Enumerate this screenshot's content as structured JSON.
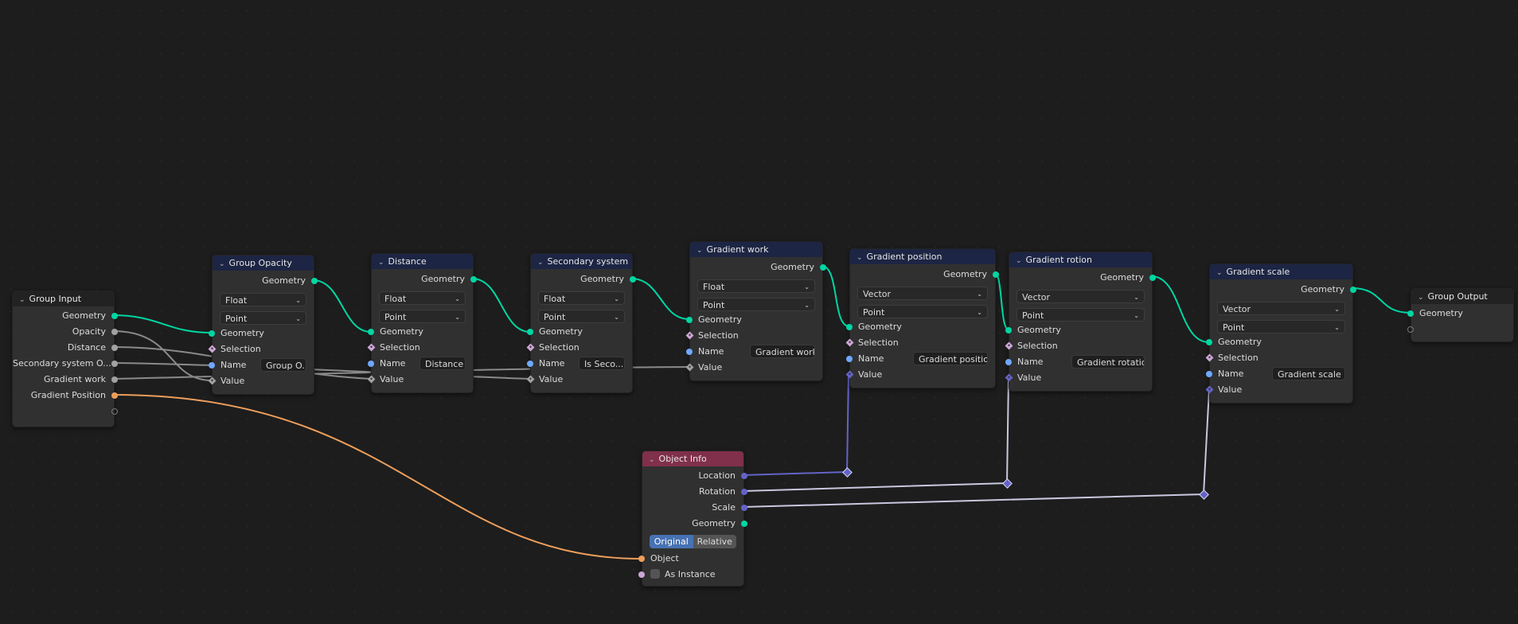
{
  "editor": {
    "type": "Geometry Node Editor"
  },
  "colors": {
    "geometry": "#00d6a3",
    "float": "#a1a1a1",
    "string": "#6fa8ff",
    "object": "#ed9e5c",
    "vector": "#6363c7",
    "boolean": "#cca6d6",
    "group_header": "#222222",
    "attribute_header": "#1d2544",
    "input_header": "#80304a"
  },
  "nodes": {
    "group_input": {
      "title": "Group Input",
      "outputs": [
        "Geometry",
        "Opacity",
        "Distance",
        "Secondary system O...",
        "Gradient work",
        "Gradient Position"
      ]
    },
    "group_opacity": {
      "title": "Group Opacity",
      "output": "Geometry",
      "data_type": "Float",
      "domain": "Point",
      "inputs": {
        "geometry": "Geometry",
        "selection": "Selection",
        "name": "Name",
        "value": "Value"
      },
      "name_value": "Group O..."
    },
    "distance": {
      "title": "Distance",
      "output": "Geometry",
      "data_type": "Float",
      "domain": "Point",
      "inputs": {
        "geometry": "Geometry",
        "selection": "Selection",
        "name": "Name",
        "value": "Value"
      },
      "name_value": "Distance"
    },
    "secondary_system": {
      "title": "Secondary system",
      "output": "Geometry",
      "data_type": "Float",
      "domain": "Point",
      "inputs": {
        "geometry": "Geometry",
        "selection": "Selection",
        "name": "Name",
        "value": "Value"
      },
      "name_value": "Is Seco..."
    },
    "gradient_work": {
      "title": "Gradient work",
      "output": "Geometry",
      "data_type": "Float",
      "domain": "Point",
      "inputs": {
        "geometry": "Geometry",
        "selection": "Selection",
        "name": "Name",
        "value": "Value"
      },
      "name_value": "Gradient work"
    },
    "gradient_position": {
      "title": "Gradient position",
      "output": "Geometry",
      "data_type": "Vector",
      "domain": "Point",
      "inputs": {
        "geometry": "Geometry",
        "selection": "Selection",
        "name": "Name",
        "value": "Value"
      },
      "name_value": "Gradient position"
    },
    "gradient_rotion": {
      "title": "Gradient rotion",
      "output": "Geometry",
      "data_type": "Vector",
      "domain": "Point",
      "inputs": {
        "geometry": "Geometry",
        "selection": "Selection",
        "name": "Name",
        "value": "Value"
      },
      "name_value": "Gradient rotation"
    },
    "gradient_scale": {
      "title": "Gradient scale",
      "output": "Geometry",
      "data_type": "Vector",
      "domain": "Point",
      "inputs": {
        "geometry": "Geometry",
        "selection": "Selection",
        "name": "Name",
        "value": "Value"
      },
      "name_value": "Gradient scale"
    },
    "group_output": {
      "title": "Group Output",
      "inputs": [
        "Geometry"
      ]
    },
    "object_info": {
      "title": "Object Info",
      "outputs": [
        "Location",
        "Rotation",
        "Scale",
        "Geometry"
      ],
      "transform_space": {
        "options": [
          "Original",
          "Relative"
        ],
        "selected": "Original"
      },
      "inputs": {
        "object": "Object",
        "as_instance": "As Instance"
      },
      "as_instance_checked": false
    }
  },
  "icons": {
    "collapse": "chevron-down-icon",
    "dropdown": "chevron-down-icon"
  },
  "glyphs": {
    "chevron": "⌄",
    "caret": "⌄"
  }
}
